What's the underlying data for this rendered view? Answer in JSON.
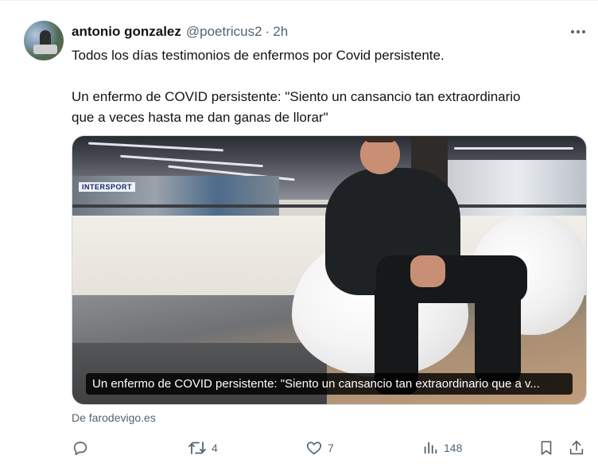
{
  "tweet": {
    "author_name": "antonio gonzalez",
    "handle": "@poetricus2",
    "separator": "·",
    "time": "2h",
    "text_line1": "Todos los días testimonios de enfermos por Covid persistente.",
    "text_line2": "Un enfermo de COVID persistente: \"Siento un cansancio tan extraordinario",
    "text_line3": "que a veces hasta me dan ganas de llorar\"",
    "more_icon": "more-icon"
  },
  "card": {
    "caption": "Un enfermo de COVID persistente: \"Siento un cansancio tan extraordinario que a v...",
    "source": "De farodevigo.es",
    "store_sign": "INTERSPORT"
  },
  "actions": {
    "reply": {
      "icon": "reply-icon",
      "count": ""
    },
    "retweet": {
      "icon": "retweet-icon",
      "count": "4"
    },
    "like": {
      "icon": "heart-icon",
      "count": "7"
    },
    "views": {
      "icon": "views-icon",
      "count": "148"
    },
    "bookmark": {
      "icon": "bookmark-icon"
    },
    "share": {
      "icon": "share-icon"
    }
  },
  "colors": {
    "text": "#0f1419",
    "secondary": "#536471",
    "border": "#cfd9de"
  }
}
